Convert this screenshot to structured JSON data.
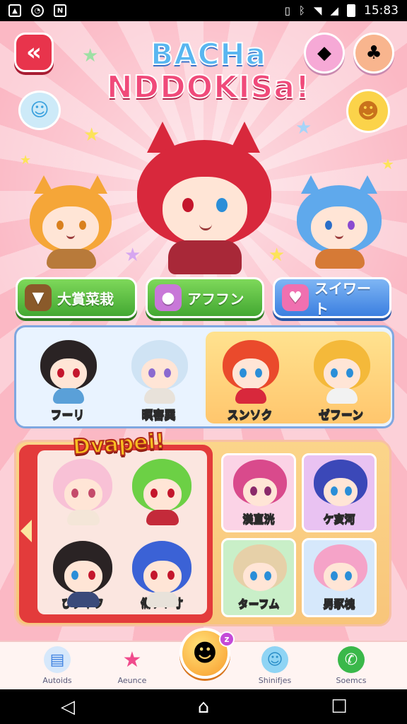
{
  "status_bar": {
    "time": "15:83",
    "notif_icons": [
      "gallery-icon",
      "whatsapp-icon",
      "nfc-icon"
    ],
    "status_icons": [
      "vibrate-icon",
      "bluetooth-icon",
      "wifi-icon",
      "signal-icon",
      "battery-icon"
    ]
  },
  "header": {
    "logo_line1": "BACHa",
    "logo_line2": "NDDOKISa!",
    "back_label": "«"
  },
  "hero_characters": {
    "colors": [
      "#f5a638",
      "#d8283c",
      "#5fa9ec"
    ]
  },
  "actions": [
    {
      "label": "大賞菜栽",
      "icon": "bucket-icon"
    },
    {
      "label": "アフフン",
      "icon": "slime-icon"
    },
    {
      "label": "スイワート",
      "icon": "heart-icon"
    }
  ],
  "roster_top": [
    {
      "name": "フーリ",
      "hair": "#2a2324"
    },
    {
      "name": "暝害巽",
      "hair": "#cfe3f4"
    },
    {
      "name": "スンソク",
      "hair": "#ea4a2c"
    },
    {
      "name": "ゼフーン",
      "hair": "#f4b93a"
    }
  ],
  "featured": {
    "title": "Dvapei!",
    "cards": [
      {
        "name": "",
        "hair": "#f8c1d6"
      },
      {
        "name": "",
        "hair": "#6cd045"
      },
      {
        "name": "ひクネフ",
        "hair": "#2a2324"
      },
      {
        "name": "備ケト寸",
        "hair": "#3b62d6"
      }
    ],
    "tiles": [
      {
        "name": "渼直洸",
        "hair": "#d94a8c",
        "bg": "#fbd3e6"
      },
      {
        "name": "ケ亥河",
        "hair": "#3b48b8",
        "bg": "#e9c2f2"
      },
      {
        "name": "ターフム",
        "hair": "#e6d0a8",
        "bg": "#c9efc8"
      },
      {
        "name": "男豕槐",
        "hair": "#f5a3c8",
        "bg": "#d6e8fb"
      }
    ]
  },
  "bottom_nav": [
    {
      "label": "Autoids",
      "icon": "basket-icon"
    },
    {
      "label": "Aeunce",
      "icon": "star-icon"
    },
    {
      "label": "Shinifjes",
      "icon": "blob-icon"
    },
    {
      "label": "Soemcs",
      "icon": "phone-icon"
    }
  ],
  "center_badge": "z"
}
